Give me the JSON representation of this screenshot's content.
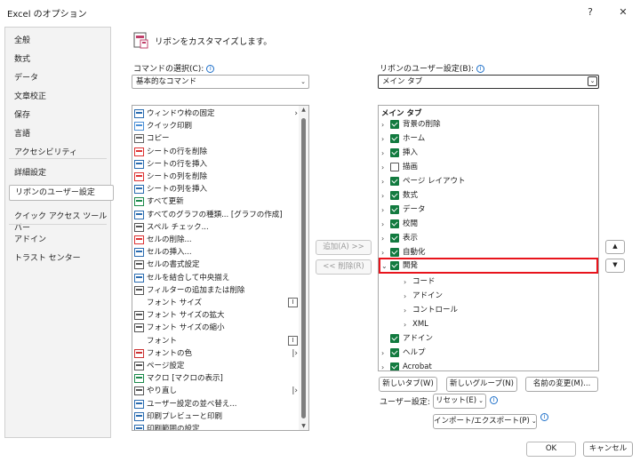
{
  "window": {
    "title": "Excel のオプション",
    "help_label": "?",
    "close_label": "✕"
  },
  "sidebar": {
    "items": [
      {
        "label": "全般"
      },
      {
        "label": "数式"
      },
      {
        "label": "データ"
      },
      {
        "label": "文章校正"
      },
      {
        "label": "保存"
      },
      {
        "label": "言語"
      },
      {
        "label": "アクセシビリティ"
      },
      {
        "label": "詳細設定"
      },
      {
        "label": "リボンのユーザー設定",
        "selected": true
      },
      {
        "label": "クイック アクセス ツール バー"
      },
      {
        "label": "アドイン"
      },
      {
        "label": "トラスト センター"
      }
    ]
  },
  "main": {
    "heading": "リボンをカスタマイズします。",
    "choose_label": "コマンドの選択(C):",
    "choose_value": "基本的なコマンド",
    "customize_label": "リボンのユーザー設定(B):",
    "customize_value": "メイン タブ",
    "commands": [
      {
        "label": "ウィンドウ枠の固定",
        "icon": "freeze-panes-icon",
        "sub": ">"
      },
      {
        "label": "クイック印刷",
        "icon": "quick-print-icon"
      },
      {
        "label": "コピー",
        "icon": "copy-icon"
      },
      {
        "label": "シートの行を削除",
        "icon": "delete-rows-icon"
      },
      {
        "label": "シートの行を挿入",
        "icon": "insert-rows-icon"
      },
      {
        "label": "シートの列を削除",
        "icon": "delete-columns-icon"
      },
      {
        "label": "シートの列を挿入",
        "icon": "insert-columns-icon"
      },
      {
        "label": "すべて更新",
        "icon": "refresh-all-icon"
      },
      {
        "label": "すべてのグラフの種類... [グラフの作成]",
        "icon": "chart-types-icon"
      },
      {
        "label": "スペル チェック...",
        "icon": "spelling-icon"
      },
      {
        "label": "セルの削除...",
        "icon": "delete-cells-icon"
      },
      {
        "label": "セルの挿入...",
        "icon": "insert-cells-icon"
      },
      {
        "label": "セルの書式設定",
        "icon": "format-cells-icon"
      },
      {
        "label": "セルを結合して中央揃え",
        "icon": "merge-center-icon"
      },
      {
        "label": "フィルターの追加または削除",
        "icon": "filter-icon"
      },
      {
        "label": "フォント サイズ",
        "icon": "",
        "sub": "I",
        "sub_boxed": true
      },
      {
        "label": "フォント サイズの拡大",
        "icon": "font-grow-icon"
      },
      {
        "label": "フォント サイズの縮小",
        "icon": "font-shrink-icon"
      },
      {
        "label": "フォント",
        "icon": "",
        "sub": "I",
        "sub_boxed": true
      },
      {
        "label": "フォントの色",
        "icon": "font-color-icon",
        "sub": "|>"
      },
      {
        "label": "ページ設定",
        "icon": "page-setup-icon"
      },
      {
        "label": "マクロ [マクロの表示]",
        "icon": "macro-icon"
      },
      {
        "label": "やり直し",
        "icon": "redo-icon",
        "sub": "|>"
      },
      {
        "label": "ユーザー設定の並べ替え...",
        "icon": "custom-sort-icon"
      },
      {
        "label": "印刷プレビューと印刷",
        "icon": "print-preview-icon"
      },
      {
        "label": "印刷範囲の設定",
        "icon": "print-area-icon"
      }
    ],
    "add_button": "追加(A) >>",
    "remove_button": "<< 削除(R)",
    "tree_header": "メイン タブ",
    "tree": [
      {
        "label": "背景の削除",
        "checked": true,
        "level": 0,
        "exp": ">"
      },
      {
        "label": "ホーム",
        "checked": true,
        "level": 0,
        "exp": ">"
      },
      {
        "label": "挿入",
        "checked": true,
        "level": 0,
        "exp": ">"
      },
      {
        "label": "描画",
        "checked": false,
        "level": 0,
        "exp": ">"
      },
      {
        "label": "ページ レイアウト",
        "checked": true,
        "level": 0,
        "exp": ">"
      },
      {
        "label": "数式",
        "checked": true,
        "level": 0,
        "exp": ">"
      },
      {
        "label": "データ",
        "checked": true,
        "level": 0,
        "exp": ">"
      },
      {
        "label": "校閲",
        "checked": true,
        "level": 0,
        "exp": ">"
      },
      {
        "label": "表示",
        "checked": true,
        "level": 0,
        "exp": ">"
      },
      {
        "label": "自動化",
        "checked": true,
        "level": 0,
        "exp": ">"
      },
      {
        "label": "開発",
        "checked": true,
        "level": 0,
        "exp": "v",
        "selected": true
      },
      {
        "label": "コード",
        "level": 1,
        "exp": ">"
      },
      {
        "label": "アドイン",
        "level": 1,
        "exp": ">"
      },
      {
        "label": "コントロール",
        "level": 1,
        "exp": ">"
      },
      {
        "label": "XML",
        "level": 1,
        "exp": ">"
      },
      {
        "label": "アドイン",
        "checked": true,
        "level": 0,
        "exp": ""
      },
      {
        "label": "ヘルプ",
        "checked": true,
        "level": 0,
        "exp": ">"
      },
      {
        "label": "Acrobat",
        "checked": true,
        "level": 0,
        "exp": ">"
      }
    ],
    "move_up": "▲",
    "move_down": "▼",
    "new_tab_button": "新しいタブ(W)",
    "new_group_button": "新しいグループ(N)",
    "rename_button": "名前の変更(M)...",
    "customizations_label": "ユーザー設定:",
    "reset_button": "リセット(E)",
    "import_export_button": "インポート/エクスポート(P)",
    "ok_button": "OK",
    "cancel_button": "キャンセル"
  },
  "colors": {
    "checkbox_green": "#127a3f",
    "highlight_red": "#e8141c",
    "info_blue": "#1d6fc9"
  }
}
